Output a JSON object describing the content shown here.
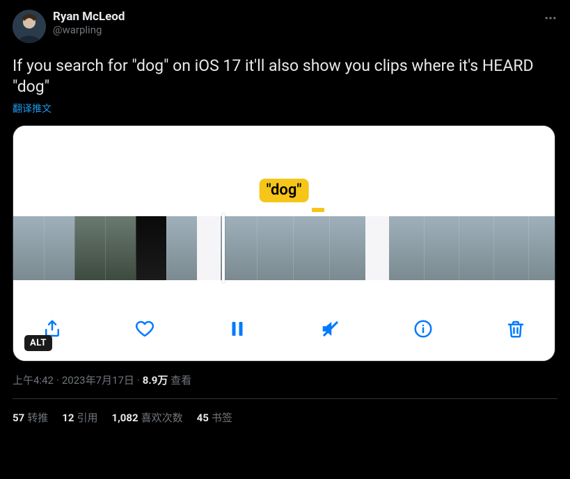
{
  "author": {
    "display_name": "Ryan McLeod",
    "handle": "@warpling"
  },
  "tweet_text": "If you search for \"dog\" on iOS 17 it'll also show you clips where it's HEARD \"dog\"",
  "translate_label": "翻译推文",
  "media": {
    "search_term": "\"dog\"",
    "alt_badge": "ALT",
    "toolbar": {
      "share": "share",
      "like": "like",
      "pause": "pause",
      "mute": "mute",
      "info": "info",
      "trash": "trash"
    }
  },
  "meta": {
    "time": "上午4:42",
    "date": "2023年7月17日",
    "views_count": "8.9万",
    "views_label": "查看"
  },
  "stats": {
    "retweets_count": "57",
    "retweets_label": "转推",
    "quotes_count": "12",
    "quotes_label": "引用",
    "likes_count": "1,082",
    "likes_label": "喜欢次数",
    "bookmarks_count": "45",
    "bookmarks_label": "书签"
  }
}
